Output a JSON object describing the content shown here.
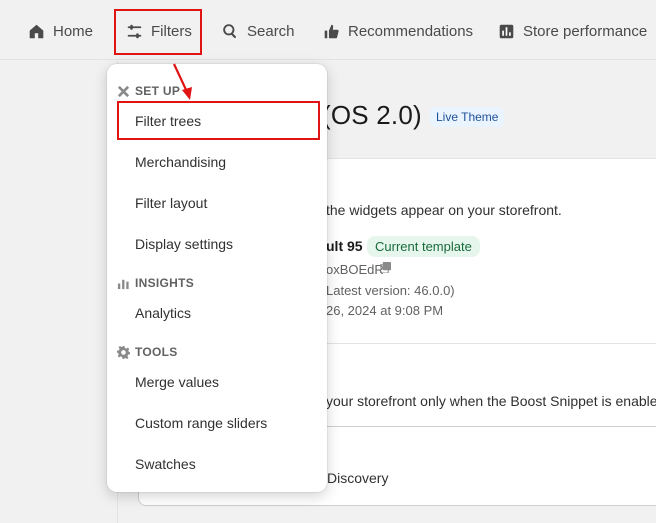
{
  "nav": {
    "home": "Home",
    "filters": "Filters",
    "search": "Search",
    "recommendations": "Recommendations",
    "store_performance": "Store performance"
  },
  "page": {
    "title_fragment": "(OS 2.0)",
    "live_badge": "Live Theme",
    "widgets_text": "the widgets appear on your storefront.",
    "template_name": "ult 95",
    "current_template_badge": "Current template",
    "theme_id": "oxBOEdR",
    "latest_version": "Latest version: 46.0.0)",
    "date": "26, 2024 at 9:08 PM",
    "snippet_text": "your storefront only when the Boost Snippet is enabled",
    "discovery": "Discovery"
  },
  "dropdown": {
    "setup_header": "SET UP",
    "filter_trees": "Filter trees",
    "merchandising": "Merchandising",
    "filter_layout": "Filter layout",
    "display_settings": "Display settings",
    "insights_header": "INSIGHTS",
    "analytics": "Analytics",
    "tools_header": "TOOLS",
    "merge_values": "Merge values",
    "custom_range_sliders": "Custom range sliders",
    "swatches": "Swatches"
  },
  "colors": {
    "highlight": "#e11414",
    "live_badge_bg": "#eaf4ff",
    "current_badge_bg": "#e6f6ec"
  }
}
